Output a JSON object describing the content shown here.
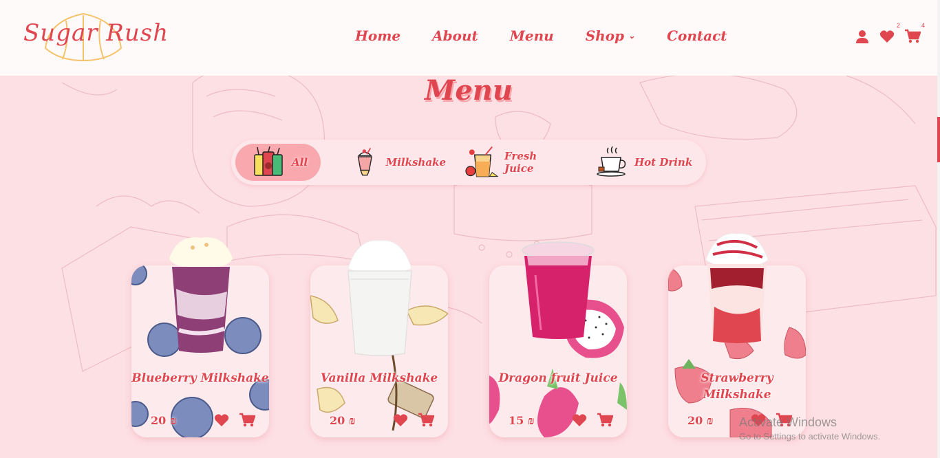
{
  "brand": {
    "name": "Sugar Rush"
  },
  "nav": {
    "items": [
      {
        "label": "Home"
      },
      {
        "label": "About"
      },
      {
        "label": "Menu"
      },
      {
        "label": "Shop",
        "has_dropdown": true
      },
      {
        "label": "Contact"
      }
    ]
  },
  "header_icons": {
    "wishlist_count": "2",
    "cart_count": "4"
  },
  "page": {
    "title": "Menu"
  },
  "filters": [
    {
      "label": "All",
      "icon": "drinks-icon",
      "active": true
    },
    {
      "label": "Milkshake",
      "icon": "milkshake-icon",
      "active": false
    },
    {
      "label": "Fresh Juice",
      "icon": "juice-icon",
      "active": false
    },
    {
      "label": "Hot Drink",
      "icon": "coffee-cup-icon",
      "active": false
    }
  ],
  "products": [
    {
      "name": "Blueberry Milkshake",
      "price": "20 ₪"
    },
    {
      "name": "Vanilla Milkshake",
      "price": "20 ₪"
    },
    {
      "name": "Dragon fruit Juice",
      "price": "15 ₪"
    },
    {
      "name": "Strawberry Milkshake",
      "price": "20 ₪"
    }
  ],
  "watermark": {
    "line1": "Activate Windows",
    "line2": "Go to Settings to activate Windows."
  },
  "colors": {
    "accent": "#e0464f",
    "background": "#fde0e4",
    "active_filter": "#f9a9ae"
  }
}
